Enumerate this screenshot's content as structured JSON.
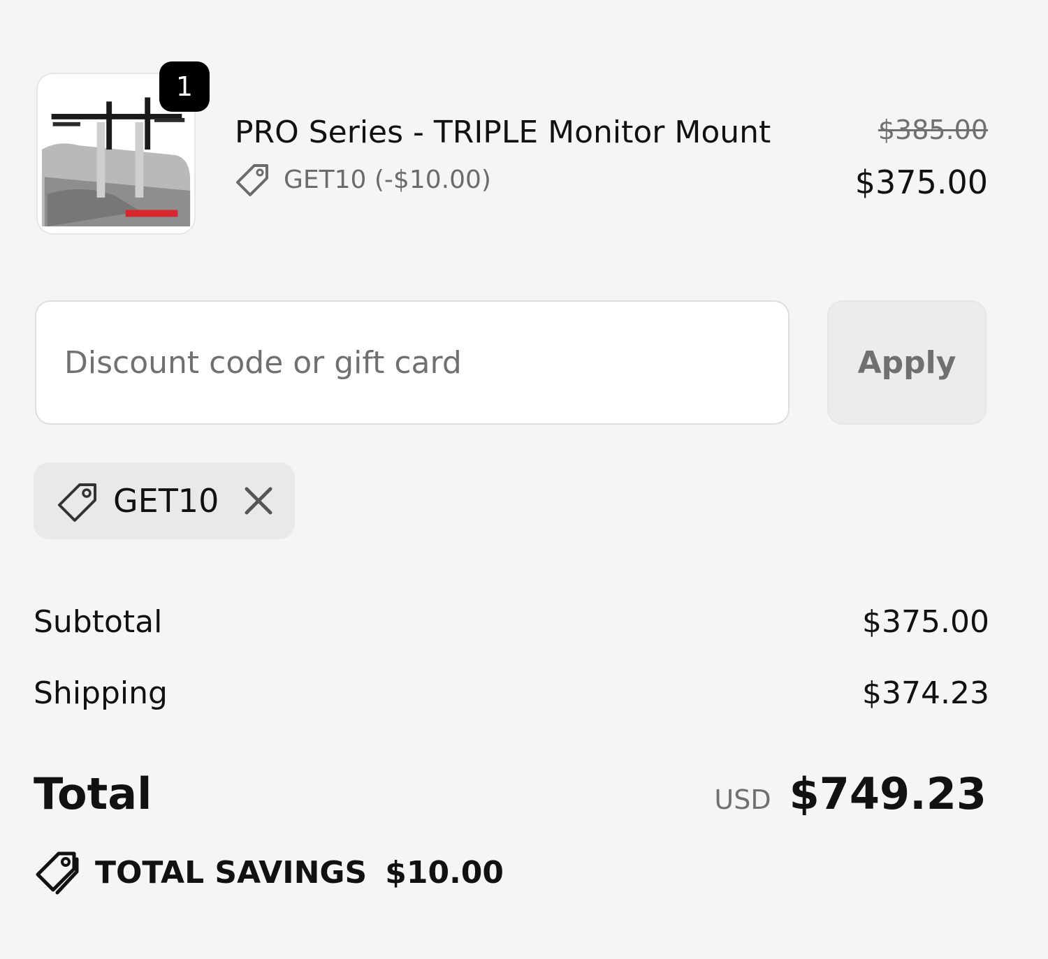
{
  "cart_item": {
    "quantity": "1",
    "title": "PRO Series - TRIPLE Monitor Mount",
    "discount_label": "GET10 (-$10.00)",
    "original_price": "$385.00",
    "current_price": "$375.00",
    "image_icon": "monitor-mount-product-image"
  },
  "discount": {
    "placeholder": "Discount code or gift card",
    "value": "",
    "apply_label": "Apply",
    "applied_code": "GET10"
  },
  "summary": {
    "subtotal_label": "Subtotal",
    "subtotal_value": "$375.00",
    "shipping_label": "Shipping",
    "shipping_value": "$374.23",
    "total_label": "Total",
    "total_currency": "USD",
    "total_value": "$749.23",
    "savings_label": "TOTAL SAVINGS",
    "savings_value": "$10.00"
  },
  "icons": {
    "discount_tag": "tag-icon",
    "remove_code": "close-icon",
    "savings": "tags-icon"
  },
  "colors": {
    "background": "#f5f5f5",
    "badge": "#000000",
    "muted_text": "#707070"
  }
}
